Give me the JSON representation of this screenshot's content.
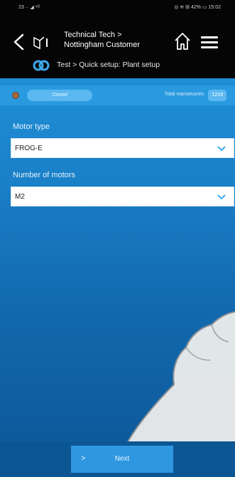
{
  "status_bar": {
    "left": "23 ·· ◢ ⁴ᴳ",
    "right": "◎ ≋ ⊞ 42% ▭ 15:02"
  },
  "header": {
    "title_line1": "Technical Tech >",
    "title_line2": "Nottingham Customer",
    "breadcrumb": "Test > Quick setup: Plant setup"
  },
  "info_bar": {
    "status": "Closed",
    "total_label": "Total manoeuvres",
    "total_value": "1219"
  },
  "form": {
    "motor_type": {
      "label": "Motor type",
      "value": "FROG-E"
    },
    "number_of_motors": {
      "label": "Number of motors",
      "value": "M2"
    }
  },
  "footer": {
    "next_label": "Next",
    "next_arrow": ">"
  },
  "colors": {
    "primary": "#1a7fc7",
    "header_bg": "#050505",
    "button": "#2f97df",
    "status_dot": "#a86a3b"
  }
}
